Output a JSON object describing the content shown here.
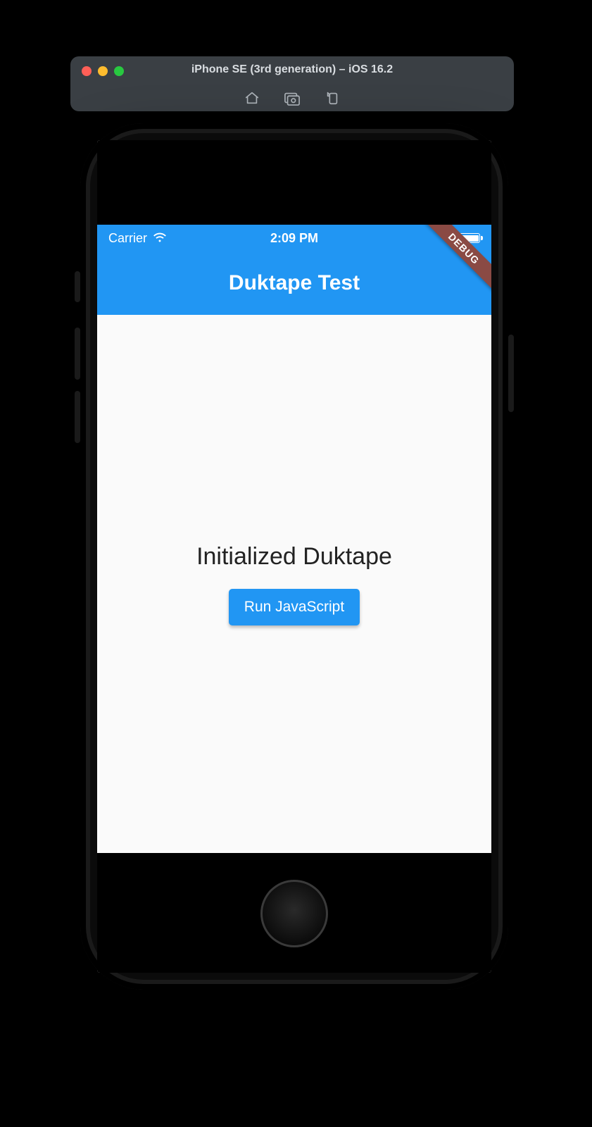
{
  "simulator": {
    "title": "iPhone SE (3rd generation) – iOS 16.2"
  },
  "statusbar": {
    "carrier": "Carrier",
    "time": "2:09 PM"
  },
  "appbar": {
    "title": "Duktape Test",
    "debug_label": "DEBUG"
  },
  "main": {
    "status_text": "Initialized Duktape",
    "run_button_label": "Run JavaScript"
  }
}
